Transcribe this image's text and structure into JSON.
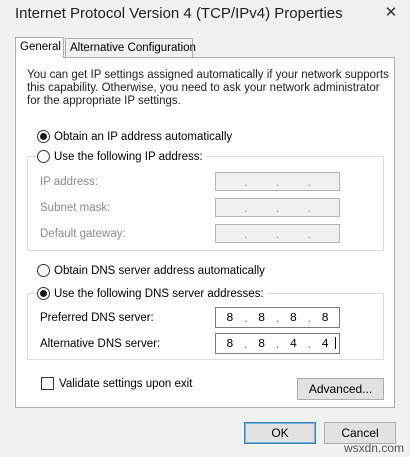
{
  "window": {
    "title": "Internet Protocol Version 4 (TCP/IPv4) Properties",
    "close_symbol": "✕"
  },
  "tabs": [
    {
      "label": "General",
      "active": true
    },
    {
      "label": "Alternative Configuration",
      "active": false
    }
  ],
  "intro_text": "You can get IP settings assigned automatically if your network supports this capability. Otherwise, you need to ask your network administrator for the appropriate IP settings.",
  "ip_section": {
    "auto_label": "Obtain an IP address automatically",
    "manual_label": "Use the following IP address:",
    "selected": "auto",
    "fields": [
      {
        "label": "IP address:",
        "octets": [
          "",
          "",
          "",
          ""
        ]
      },
      {
        "label": "Subnet mask:",
        "octets": [
          "",
          "",
          "",
          ""
        ]
      },
      {
        "label": "Default gateway:",
        "octets": [
          "",
          "",
          "",
          ""
        ]
      }
    ]
  },
  "dns_section": {
    "auto_label": "Obtain DNS server address automatically",
    "manual_label": "Use the following DNS server addresses:",
    "selected": "manual",
    "preferred": {
      "label": "Preferred DNS server:",
      "octets": [
        "8",
        "8",
        "8",
        "8"
      ]
    },
    "alternative": {
      "label": "Alternative DNS server:",
      "octets": [
        "8",
        "8",
        "4",
        "4"
      ]
    }
  },
  "validate_label": "Validate settings upon exit",
  "validate_checked": false,
  "buttons": {
    "advanced": "Advanced...",
    "ok": "OK",
    "cancel": "Cancel"
  },
  "watermark": "wsxdn.com"
}
